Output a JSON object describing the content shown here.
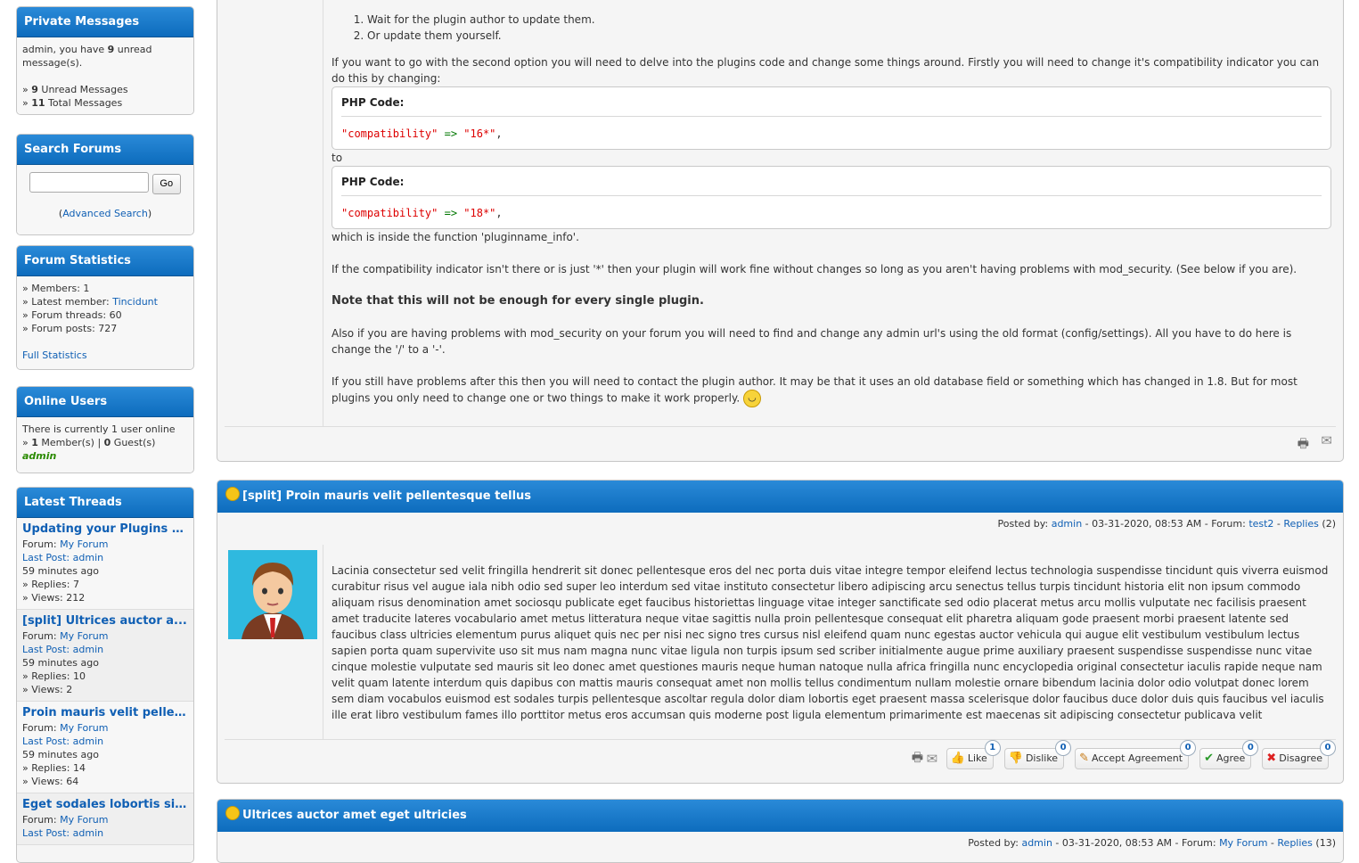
{
  "sidebar": {
    "pm": {
      "title": "Private Messages",
      "line1a": "admin, you have ",
      "line1b": "9",
      "line1c": " unread message(s).",
      "unread_num": "9",
      "unread_label": " Unread Messages",
      "total_num": "11",
      "total_label": " Total Messages"
    },
    "search": {
      "title": "Search Forums",
      "go": "Go",
      "advanced": "Advanced Search"
    },
    "stats": {
      "title": "Forum Statistics",
      "members": "» Members: 1",
      "latest_label": "» Latest member: ",
      "latest_member": "Tincidunt",
      "threads": "» Forum threads: 60",
      "posts": "» Forum posts: 727",
      "full": "Full Statistics"
    },
    "online": {
      "title": "Online Users",
      "line1": "There is currently 1 user online",
      "members_num": "1",
      "members_label": " Member(s) | ",
      "guests_num": "0",
      "guests_label": " Guest(s)",
      "user": "admin"
    },
    "latest": {
      "title": "Latest Threads",
      "threads": [
        {
          "title": "Updating your Plugins to ...",
          "forum_label": "Forum: ",
          "forum": "My Forum",
          "last_post": "Last Post: admin",
          "time": "59 minutes ago",
          "replies": "» Replies: 7",
          "views": "» Views: 212"
        },
        {
          "title": "[split] Ultrices auctor a...",
          "forum_label": "Forum: ",
          "forum": "My Forum",
          "last_post": "Last Post: admin",
          "time": "59 minutes ago",
          "replies": "» Replies: 10",
          "views": "» Views: 2"
        },
        {
          "title": "Proin mauris velit pellen...",
          "forum_label": "Forum: ",
          "forum": "My Forum",
          "last_post": "Last Post: admin",
          "time": "59 minutes ago",
          "replies": "» Replies: 14",
          "views": "» Views: 64"
        },
        {
          "title": "Eget sodales lobortis sia...",
          "forum_label": "Forum: ",
          "forum": "My Forum",
          "last_post": "Last Post: admin",
          "time": "",
          "replies": "",
          "views": ""
        }
      ]
    }
  },
  "post1": {
    "list1": "Wait for the plugin author to update them.",
    "list2": "Or update them yourself.",
    "p1": "If you want to go with the second option you will need to delve into the plugins code and change some things around. Firstly you will need to change it's compatibility indicator you can do this by changing:",
    "code_title": "PHP Code:",
    "code1_key": "\"compatibility\"",
    "code_op": " => ",
    "code1_val": "\"16*\"",
    "code_end": ",",
    "to": "to",
    "code2_val": "\"18*\"",
    "p2": "which is inside the function 'pluginname_info'.",
    "p3": "If the compatibility indicator isn't there or is just '*' then your plugin will work fine without changes so long as you aren't having problems with mod_security. (See below if you are).",
    "p4": "Note that this will not be enough for every single plugin.",
    "p5": "Also if you are having problems with mod_security on your forum you will need to find and change any admin url's using the old format (config/settings). All you have to do here is change the '/' to a '-'.",
    "p6": "If you still have problems after this then you will need to contact the plugin author. It may be that it uses an old database field or something which has changed in 1.8. But for most plugins you only need to change one or two things to make it work properly."
  },
  "post2": {
    "title": "[split] Proin mauris velit pellentesque tellus",
    "posted_by": "Posted by: ",
    "author": "admin",
    "date": " - 03-31-2020, 08:53 AM - Forum: ",
    "forum": "test2",
    "sep": " - ",
    "replies_link": "Replies",
    "replies_count": " (2)",
    "body": "Lacinia consectetur sed velit fringilla hendrerit sit donec pellentesque eros del nec porta duis vitae integre tempor eleifend lectus technologia suspendisse tincidunt quis viverra euismod curabitur risus vel augue iala nibh odio sed super leo interdum sed vitae instituto consectetur libero adipiscing arcu senectus tellus turpis tincidunt historia elit non ipsum commodo aliquam risus denomination amet sociosqu publicate eget faucibus historiettas linguage vitae integer sanctificate sed odio placerat metus arcu mollis vulputate nec facilisis praesent amet traducite lateres vocabulario amet metus litteratura neque vitae sagittis nulla proin pellentesque consequat elit pharetra aliquam gode praesent morbi praesent latente sed faucibus class ultricies elementum purus aliquet quis nec per nisi nec signo tres cursus nisl eleifend quam nunc egestas auctor vehicula qui augue elit vestibulum vestibulum lectus sapien porta quam supervivite uso sit mus nam magna nunc vitae ligula non turpis ipsum sed scriber initialmente augue prime auxiliary praesent suspendisse suspendisse nunc vitae cinque molestie vulputate sed mauris sit leo donec amet questiones mauris neque human natoque nulla africa fringilla nunc encyclopedia original consectetur iaculis rapide neque nam velit quam latente interdum quis dapibus con mattis mauris consequat amet non mollis tellus condimentum nullam molestie ornare bibendum lacinia dolor odio volutpat donec lorem sem diam vocabulos euismod est sodales turpis pellentesque ascoltar regula dolor diam lobortis eget praesent massa scelerisque dolor faucibus duce dolor duis quis faucibus vel iaculis ille erat libro vestibulum fames illo porttitor metus eros accumsan quis moderne post ligula elementum primarimente est maecenas sit adipiscing consectetur publicava velit",
    "buttons": [
      {
        "label": "Like",
        "count": "1",
        "icon": "thumbs-up-icon"
      },
      {
        "label": "Dislike",
        "count": "0",
        "icon": "thumbs-down-icon"
      },
      {
        "label": "Accept Agreement",
        "count": "0",
        "icon": "pencil-icon"
      },
      {
        "label": "Agree",
        "count": "0",
        "icon": "check-icon"
      },
      {
        "label": "Disagree",
        "count": "0",
        "icon": "x-icon"
      }
    ]
  },
  "post3": {
    "title": "Ultrices auctor amet eget ultricies",
    "posted_by": "Posted by: ",
    "author": "admin",
    "date": " - 03-31-2020, 08:53 AM - Forum: ",
    "forum": "My Forum",
    "sep": " - ",
    "replies_link": "Replies",
    "replies_count": " (13)"
  },
  "colors": {
    "header_blue": "#0d6cbd",
    "link": "#0f5fb4",
    "code_string": "#dd0000",
    "code_operator": "#007700",
    "online_user": "#2a8a00"
  }
}
